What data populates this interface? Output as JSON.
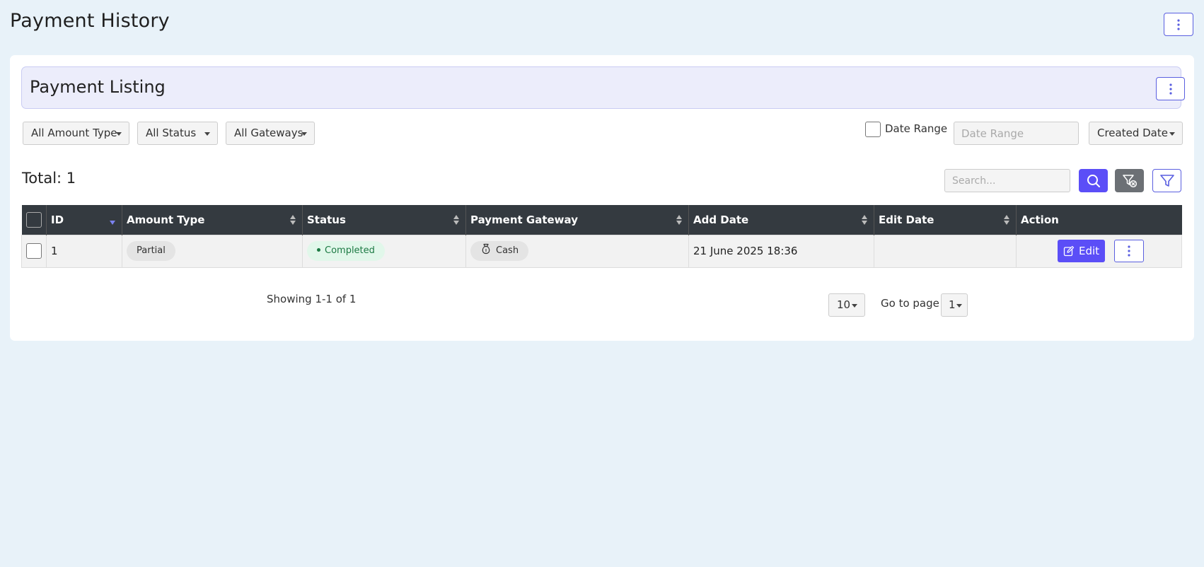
{
  "page": {
    "title": "Payment History"
  },
  "card": {
    "title": "Payment Listing"
  },
  "filters": {
    "amount_type": "All Amount Type",
    "status": "All Status",
    "gateways": "All Gateways",
    "date_range_label": "Date Range",
    "date_range_placeholder": "Date Range",
    "date_field": "Created Date"
  },
  "summary": {
    "total": "Total: 1"
  },
  "search": {
    "placeholder": "Search..."
  },
  "table": {
    "columns": [
      "ID",
      "Amount Type",
      "Status",
      "Payment Gateway",
      "Add Date",
      "Edit Date",
      "Action"
    ],
    "rows": [
      {
        "id": "1",
        "amount_type": "Partial",
        "status": "Completed",
        "gateway": "Cash",
        "add_date": "21 June 2025 18:36",
        "edit_date": "",
        "edit_label": "Edit"
      }
    ]
  },
  "pagination": {
    "showing": "Showing 1-1 of 1",
    "page_size": "10",
    "goto_label": "Go to page",
    "current_page": "1"
  },
  "colors": {
    "accent": "#5b4ef7",
    "header_bg": "#343a40",
    "page_bg": "#e8f2f9",
    "status_green": "#1d7a44"
  }
}
